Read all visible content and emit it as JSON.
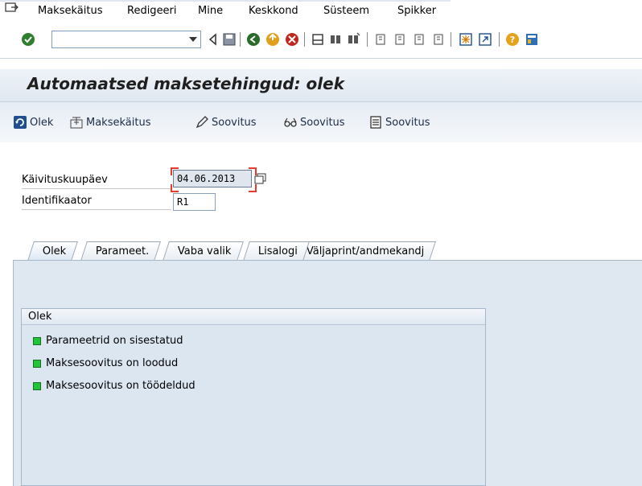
{
  "menu": {
    "items": [
      "Maksekäitus",
      "Redigeeri",
      "Mine",
      "Keskkond",
      "Süsteem",
      "Spikker"
    ]
  },
  "toolbar": {
    "command_field_value": ""
  },
  "page": {
    "title": "Automaatsed maksetehingud: olek"
  },
  "app_toolbar": {
    "buttons": [
      "Olek",
      "Maksekäitus",
      "Soovitus",
      "Soovitus",
      "Soovitus"
    ]
  },
  "form": {
    "run_date_label": "Käivituskuupäev",
    "run_date_value": "04.06.2013",
    "identifier_label": "Identifikaator",
    "identifier_value": "R1"
  },
  "tabs": [
    "Olek",
    "Parameet.",
    "Vaba valik",
    "Lisalogi",
    "Väljaprint/andmekandj"
  ],
  "status_group": {
    "title": "Olek",
    "items": [
      "Parameetrid on sisestatud",
      "Maksesoovitus on loodud",
      "Maksesoovitus on töödeldud"
    ]
  },
  "colors": {
    "status_green": "#22c43a",
    "title_bg": "#dfe7f0",
    "panel_bg": "#dfe8f1"
  }
}
